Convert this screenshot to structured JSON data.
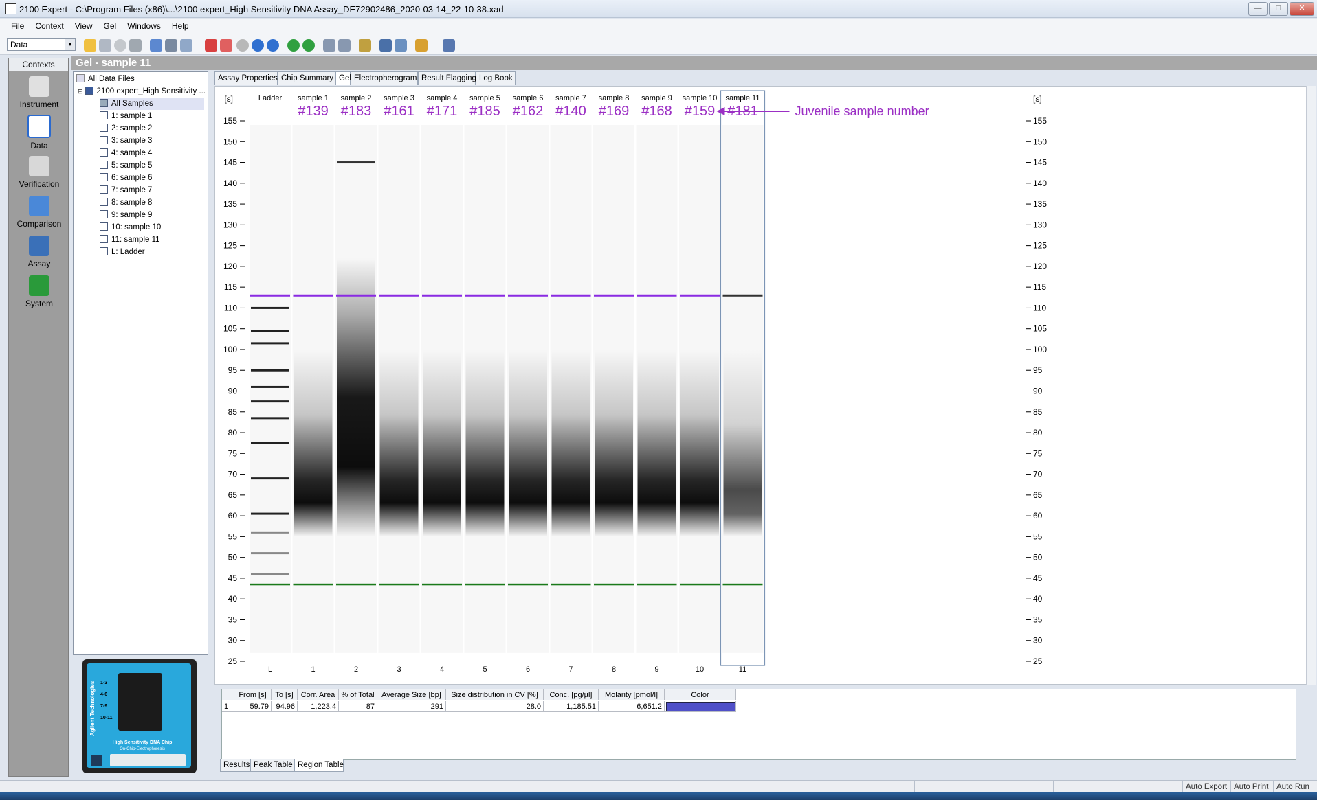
{
  "window": {
    "title": "2100 Expert - C:\\Program Files (x86)\\...\\2100 expert_High Sensitivity DNA Assay_DE72902486_2020-03-14_22-10-38.xad"
  },
  "menu": [
    "File",
    "Context",
    "View",
    "Gel",
    "Windows",
    "Help"
  ],
  "toolbar": {
    "context_select": "Data"
  },
  "contexts": {
    "header": "Contexts",
    "items": [
      "Instrument",
      "Data",
      "Verification",
      "Comparison",
      "Assay",
      "System"
    ]
  },
  "panel_title": "Gel - sample 11",
  "tree": {
    "root": "All Data Files",
    "file": "2100 expert_High Sensitivity ...",
    "items": [
      "All Samples",
      "1: sample 1",
      "2: sample 2",
      "3: sample 3",
      "4: sample 4",
      "5: sample 5",
      "6: sample 6",
      "7: sample 7",
      "8: sample 8",
      "9: sample 9",
      "10: sample 10",
      "11: sample 11",
      "L: Ladder"
    ]
  },
  "tabs": [
    "Assay Properties",
    "Chip Summary",
    "Gel",
    "Electropherogram",
    "Result Flagging",
    "Log Book"
  ],
  "chip": {
    "brand": "Agilent Technologies",
    "name": "High Sensitivity DNA Chip",
    "sub": "On-Chip-Electrophoresis",
    "rows": [
      "1-3",
      "4-6",
      "7-9",
      "10-11"
    ]
  },
  "gel": {
    "axis_unit": "[s]",
    "ticks": [
      155,
      150,
      145,
      140,
      135,
      130,
      125,
      120,
      115,
      110,
      105,
      100,
      95,
      90,
      85,
      80,
      75,
      70,
      65,
      60,
      55,
      50,
      45,
      40,
      35,
      30,
      25
    ],
    "lane_headers": [
      "Ladder",
      "sample 1",
      "sample 2",
      "sample 3",
      "sample 4",
      "sample 5",
      "sample 6",
      "sample 7",
      "sample 8",
      "sample 9",
      "sample 10",
      "sample 11"
    ],
    "lane_numbers": [
      "L",
      "1",
      "2",
      "3",
      "4",
      "5",
      "6",
      "7",
      "8",
      "9",
      "10",
      "11"
    ],
    "annotations": [
      "",
      "#139",
      "#183",
      "#161",
      "#171",
      "#185",
      "#162",
      "#140",
      "#169",
      "#168",
      "#159",
      "#181"
    ],
    "annotation_note": "Juvenile sample number",
    "annotation_color": "#9b2fc4",
    "upper_marker_color": "#8a2be2",
    "lower_marker_color": "#1a7a1a",
    "selected_lane": "sample 11"
  },
  "region_table": {
    "headers": [
      "From [s]",
      "To [s]",
      "Corr. Area",
      "% of Total",
      "Average Size [bp]",
      "Size distribution in CV [%]",
      "Conc. [pg/µl]",
      "Molarity [pmol/l]",
      "Color"
    ],
    "rows": [
      [
        "1",
        "59.79",
        "94.96",
        "1,223.4",
        "87",
        "291",
        "28.0",
        "1,185.51",
        "6,651.2"
      ]
    ],
    "swatch_color": "#5050c8"
  },
  "bottom_tabs": [
    "Results",
    "Peak Table",
    "Region Table"
  ],
  "status": [
    "Auto Export",
    "Auto Print",
    "Auto Run"
  ]
}
